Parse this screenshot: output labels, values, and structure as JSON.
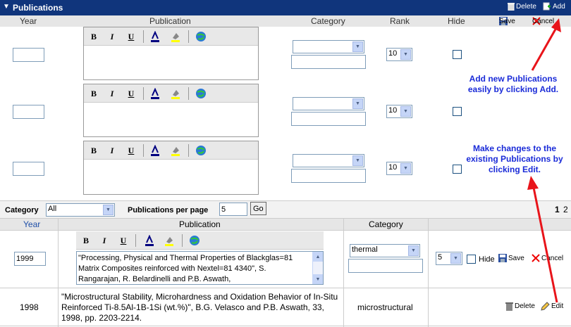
{
  "header": {
    "title": "Publications",
    "delete_label": "Delete",
    "add_label": "Add"
  },
  "columns": {
    "year": "Year",
    "publication": "Publication",
    "category": "Category",
    "rank": "Rank",
    "hide": "Hide",
    "save_label": "Save",
    "cancel_label": "Cancel"
  },
  "new_rows": [
    {
      "rank": "10"
    },
    {
      "rank": "10"
    },
    {
      "rank": "10"
    }
  ],
  "annotations": {
    "add_note": "Add new Publications easily by clicking Add.",
    "edit_note": "Make changes to the existing Publications by clicking Edit."
  },
  "filter": {
    "category_label": "Category",
    "category_value": "All",
    "per_page_label": "Publications per page",
    "per_page_value": "5",
    "go_label": "Go",
    "page_current": "1",
    "page_next": "2"
  },
  "list_columns": {
    "year": "Year",
    "publication": "Publication",
    "category": "Category"
  },
  "editing_row": {
    "year": "1999",
    "publication": "\"Processing, Physical and Thermal Properties of Blackglas=81 Matrix Composites reinforced with Nextel=81 4340\", S. Rangarajan, R. Belardinelli and P.B. Aswath,",
    "category": "thermal",
    "rank": "5",
    "hide_label": "Hide",
    "save_label": "Save",
    "cancel_label": "Cancel"
  },
  "rows": [
    {
      "year": "1998",
      "publication": "\"Microstructural Stability, Microhardness and Oxidation Behavior of In-Situ Reinforced Ti-8.5Al-1B-1Si (wt.%)\", B.G. Velasco and P.B. Aswath, 33, 1998, pp. 2203-2214.",
      "category": "microstructural",
      "delete_label": "Delete",
      "edit_label": "Edit"
    }
  ],
  "colors": {
    "titlebar": "#10357c",
    "annotation_text": "#1a2bd8",
    "arrow": "#e8141a",
    "link_blue": "#1f4fa8"
  }
}
